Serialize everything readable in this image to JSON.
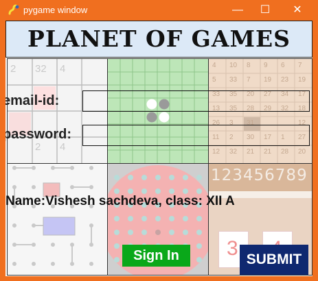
{
  "window": {
    "title": "pygame window",
    "minimize_glyph": "—",
    "maximize_glyph": "☐",
    "close_glyph": "✕"
  },
  "header": {
    "title": "PLANET OF GAMES"
  },
  "form": {
    "email_label": "email-id:",
    "email_value": "",
    "password_label": "password:",
    "password_value": ""
  },
  "credit": "Name:Vishesh sachdeva, class: XII A",
  "buttons": {
    "signin_label": "Sign In",
    "submit_label": "SUBMIT"
  },
  "thumbnails": {
    "game_2048": {
      "numbers": [
        "2",
        "32",
        "4",
        "4",
        "2"
      ]
    },
    "number_board": {
      "rows": [
        [
          "4",
          "10",
          "8",
          "9",
          "6",
          "7"
        ],
        [
          "5",
          "33",
          "7",
          "19",
          "23",
          "19"
        ],
        [
          "33",
          "35",
          "20",
          "27",
          "34",
          "17"
        ],
        [
          "13",
          "35",
          "28",
          "29",
          "32",
          "18"
        ],
        [
          "26",
          "3",
          "31",
          "",
          "",
          "12"
        ],
        [
          "11",
          "2",
          "30",
          "17",
          "1",
          "27"
        ],
        [
          "12",
          "32",
          "21",
          "21",
          "28",
          "20"
        ]
      ]
    },
    "number_strip": {
      "digits": "123456789"
    },
    "card_numbers": [
      "3",
      "4"
    ]
  },
  "colors": {
    "titlebar": "#f06f1f",
    "header_bg": "#dce9f7",
    "signin_bg": "#0aa81a",
    "submit_bg": "#0f2870"
  }
}
